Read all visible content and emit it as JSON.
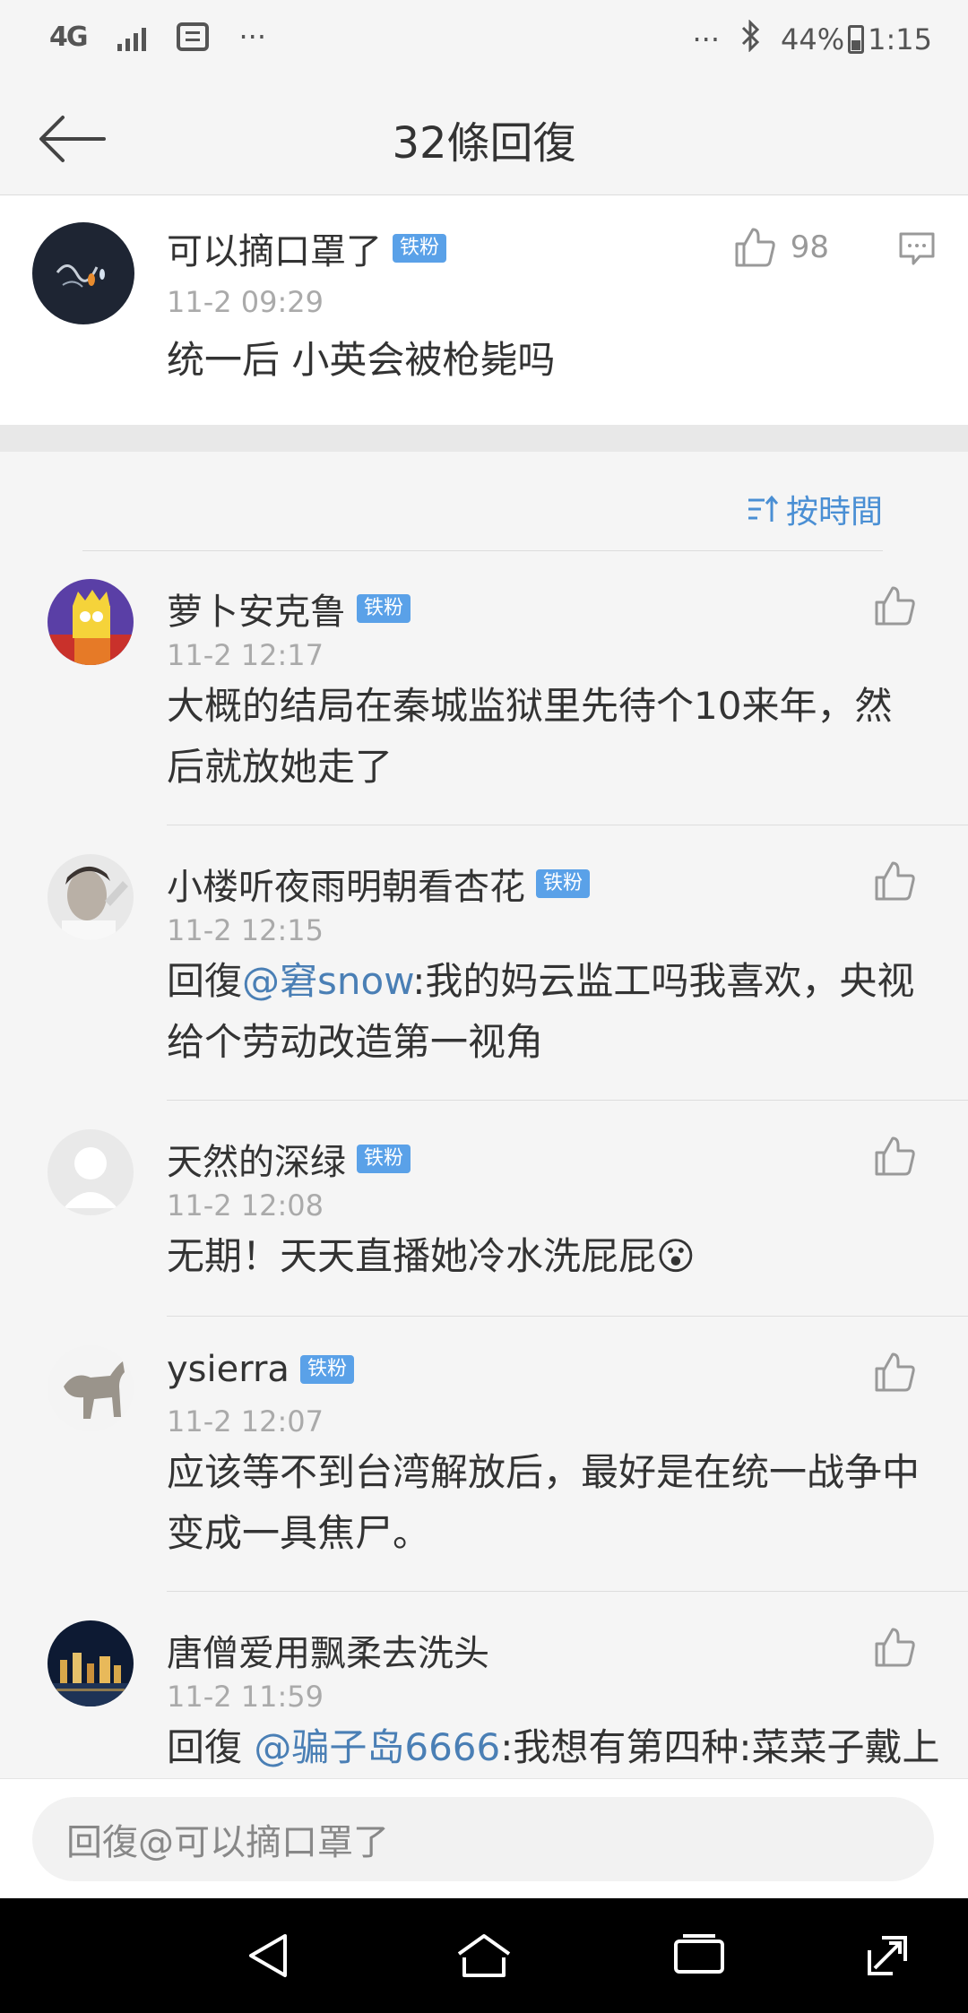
{
  "status_bar": {
    "network": "4G",
    "more_left": "···",
    "more_right": "···",
    "battery": "44%",
    "time": "1:15"
  },
  "header": {
    "title": "32條回復"
  },
  "main_comment": {
    "username": "可以摘口罩了",
    "badge": "铁粉",
    "timestamp": "11-2 09:29",
    "content": "统一后 小英会被枪毙吗",
    "likes": "98"
  },
  "sort": {
    "label": "按時間"
  },
  "replies": [
    {
      "username": "萝卜安克鲁",
      "badge": "铁粉",
      "timestamp": "11-2 12:17",
      "content": "大概的结局在秦城监狱里先待个10来年，然后就放她走了"
    },
    {
      "username": "小楼听夜雨明朝看杏花",
      "badge": "铁粉",
      "timestamp": "11-2 12:15",
      "prefix": "回復",
      "mention": "@窘snow",
      "content": ":我的妈云监工吗我喜欢，央视给个劳动改造第一视角"
    },
    {
      "username": "天然的深绿",
      "badge": "铁粉",
      "timestamp": "11-2 12:08",
      "content": "无期！天天直播她冷水洗屁屁",
      "emoji": "😮"
    },
    {
      "username": "ysierra",
      "badge": "铁粉",
      "timestamp": "11-2 12:07",
      "content": "应该等不到台湾解放后，最好是在统一战争中变成一具焦尸。"
    },
    {
      "username": "唐僧爱用飘柔去洗头",
      "timestamp": "11-2 11:59",
      "prefix": "回復 ",
      "mention": "@骗子岛6666",
      "content": ":我想有第四种:菜菜子戴上"
    }
  ],
  "input": {
    "placeholder": "回復@可以摘口罩了"
  },
  "colors": {
    "accent": "#4a8fd4",
    "badge": "#5aa1e8",
    "mention": "#4a7fb5"
  }
}
